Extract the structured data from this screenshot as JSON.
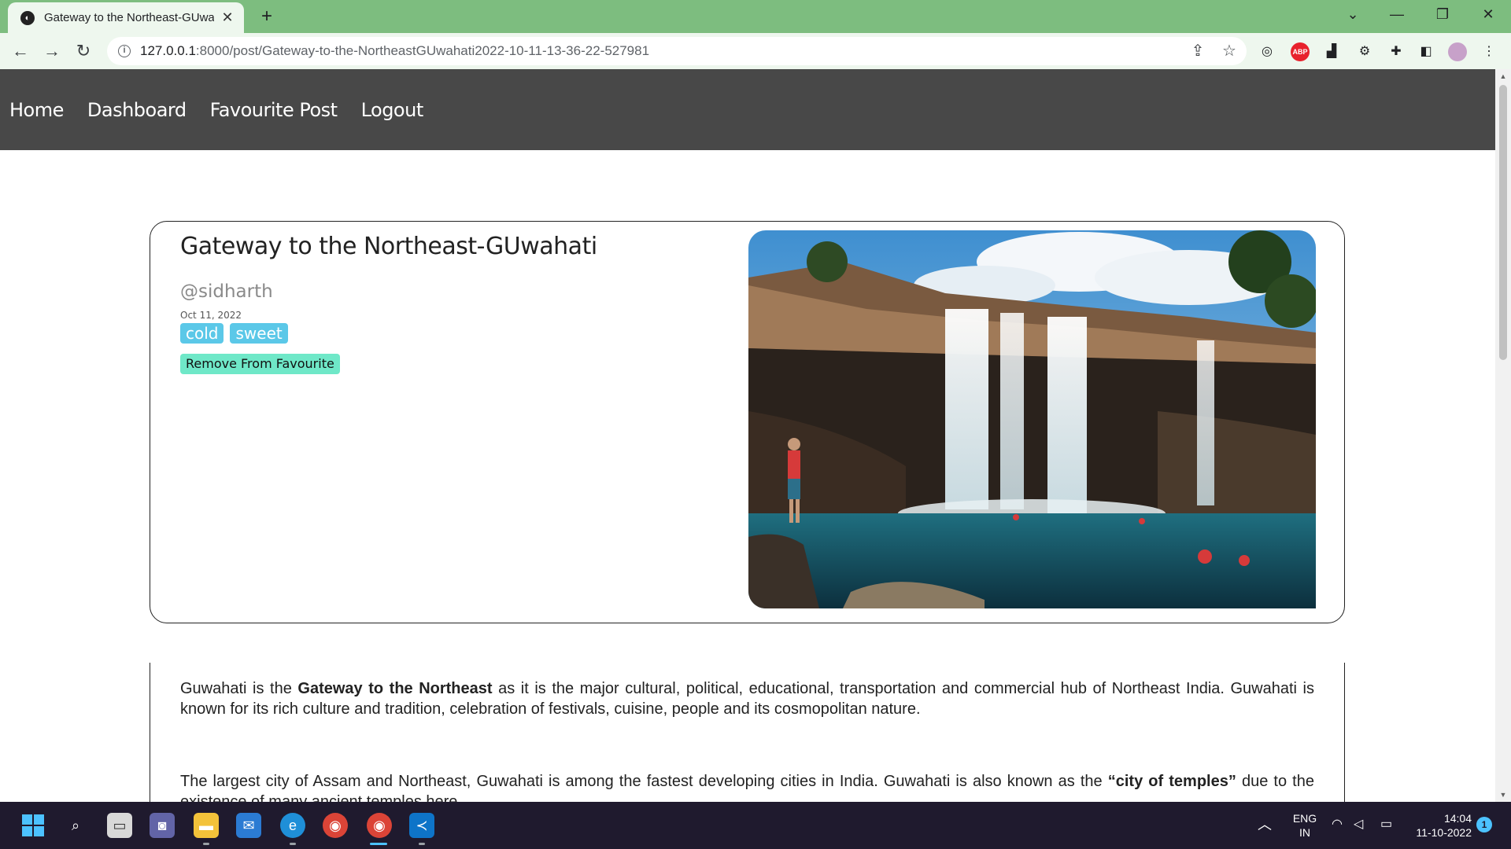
{
  "browser": {
    "tab_title": "Gateway to the Northeast-GUwahati",
    "url_host": "127.0.0.1",
    "url_path": ":8000/post/Gateway-to-the-NortheastGUwahati2022-10-11-13-36-22-527981",
    "abp_label": "ABP"
  },
  "nav": {
    "links": [
      "Home",
      "Dashboard",
      "Favourite Post",
      "Logout"
    ]
  },
  "post": {
    "title": "Gateway to the Northeast-GUwahati",
    "author": "@sidharth",
    "date": "Oct 11, 2022",
    "tags": [
      "cold",
      "sweet"
    ],
    "favourite_button": "Remove From Favourite",
    "body": [
      {
        "before": "Guwahati is the ",
        "bold": "Gateway to the Northeast",
        "after": " as it is the major cultural, political, educational, transportation and commercial hub of Northeast India. Guwahati is known for its rich culture and tradition, celebration of festivals, cuisine, people and its cosmopolitan nature."
      },
      {
        "before": "The largest city of Assam and Northeast, Guwahati is among the fastest developing cities in India. Guwahati is also known as the ",
        "bold": "“city of temples”",
        "after": " due to the existence of many ancient temples here."
      }
    ]
  },
  "taskbar": {
    "language_1": "ENG",
    "language_2": "IN",
    "time": "14:04",
    "date": "11-10-2022",
    "notification_count": "1"
  },
  "colors": {
    "tab_strip": "#7dbd7f",
    "nav_bg": "#484848",
    "tag_bg": "#5bc8e8",
    "fav_button_bg": "#6fe8c8"
  }
}
